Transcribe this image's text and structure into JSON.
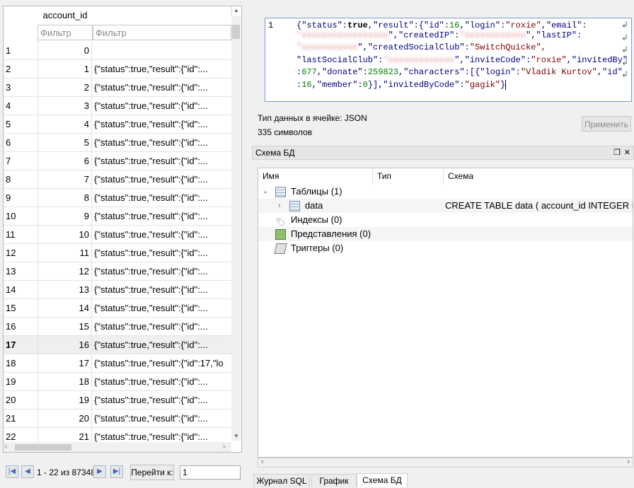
{
  "grid": {
    "column_header": "account_id",
    "filter_placeholder": "Фильтр",
    "rows": [
      {
        "num": "1",
        "id": "0",
        "value": ""
      },
      {
        "num": "2",
        "id": "1",
        "value": "{\"status\":true,\"result\":{\"id\":..."
      },
      {
        "num": "3",
        "id": "2",
        "value": "{\"status\":true,\"result\":{\"id\":..."
      },
      {
        "num": "4",
        "id": "3",
        "value": "{\"status\":true,\"result\":{\"id\":..."
      },
      {
        "num": "5",
        "id": "4",
        "value": "{\"status\":true,\"result\":{\"id\":..."
      },
      {
        "num": "6",
        "id": "5",
        "value": "{\"status\":true,\"result\":{\"id\":..."
      },
      {
        "num": "7",
        "id": "6",
        "value": "{\"status\":true,\"result\":{\"id\":..."
      },
      {
        "num": "8",
        "id": "7",
        "value": "{\"status\":true,\"result\":{\"id\":..."
      },
      {
        "num": "9",
        "id": "8",
        "value": "{\"status\":true,\"result\":{\"id\":..."
      },
      {
        "num": "10",
        "id": "9",
        "value": "{\"status\":true,\"result\":{\"id\":..."
      },
      {
        "num": "11",
        "id": "10",
        "value": "{\"status\":true,\"result\":{\"id\":..."
      },
      {
        "num": "12",
        "id": "11",
        "value": "{\"status\":true,\"result\":{\"id\":..."
      },
      {
        "num": "13",
        "id": "12",
        "value": "{\"status\":true,\"result\":{\"id\":..."
      },
      {
        "num": "14",
        "id": "13",
        "value": "{\"status\":true,\"result\":{\"id\":..."
      },
      {
        "num": "15",
        "id": "14",
        "value": "{\"status\":true,\"result\":{\"id\":..."
      },
      {
        "num": "16",
        "id": "15",
        "value": "{\"status\":true,\"result\":{\"id\":..."
      },
      {
        "num": "17",
        "id": "16",
        "value": "{\"status\":true,\"result\":{\"id\":..."
      },
      {
        "num": "18",
        "id": "17",
        "value": "{\"status\":true,\"result\":{\"id\":17,\"lo"
      },
      {
        "num": "19",
        "id": "18",
        "value": "{\"status\":true,\"result\":{\"id\":..."
      },
      {
        "num": "20",
        "id": "19",
        "value": "{\"status\":true,\"result\":{\"id\":..."
      },
      {
        "num": "21",
        "id": "20",
        "value": "{\"status\":true,\"result\":{\"id\":..."
      },
      {
        "num": "22",
        "id": "21",
        "value": "{\"status\":true,\"result\":{\"id\":..."
      }
    ],
    "selected_row": "17"
  },
  "nav": {
    "range_text": "1 - 22 из 87348",
    "goto_label": "Перейти к:",
    "goto_value": "1"
  },
  "editor": {
    "line_number": "1",
    "lines": [
      [
        "{\"status\":",
        "true",
        ",\"result\":{\"id\":",
        "16",
        ",\"login\":",
        "\"roxie\"",
        ",\"email\":"
      ],
      [
        "\",\"createdIP\":",
        "\",\"lastIP\":"
      ],
      [
        "\",\"createdSocialClub\":",
        "\"SwitchQuicke\","
      ],
      [
        "\"lastSocialClub\":",
        "\",\"inviteCode\":",
        "\"roxie\"",
        ",\"invitedBy\""
      ],
      [
        ":",
        "677",
        ",\"donate\":",
        "259823",
        ",\"characters\":[{\"login\":",
        "\"Vladik Kurtov\"",
        ",\"id\""
      ],
      [
        ":",
        "16",
        ",\"member\":",
        "0",
        "}],\"invitedByCode\":",
        "\"gagik\"",
        "}"
      ]
    ]
  },
  "cell_info": {
    "type_text": "Тип данных в ячейке: JSON",
    "chars_text": "335 символов",
    "apply_label": "Применить"
  },
  "schema": {
    "title": "Схема БД",
    "headers": {
      "name": "Имя",
      "type": "Тип",
      "schema": "Схема"
    },
    "tables": "Таблицы (1)",
    "table_data": "data",
    "table_data_schema": "CREATE TABLE data ( account_id INTEGER PRI",
    "indexes": "Индексы (0)",
    "views": "Представления (0)",
    "triggers": "Триггеры (0)"
  },
  "tabs": [
    "Журнал SQL",
    "График",
    "Схема БД"
  ],
  "active_tab": "Схема БД",
  "colors": {
    "accent": "#3d6fb7",
    "key": "#000080",
    "string": "#800000",
    "number": "#008000"
  }
}
